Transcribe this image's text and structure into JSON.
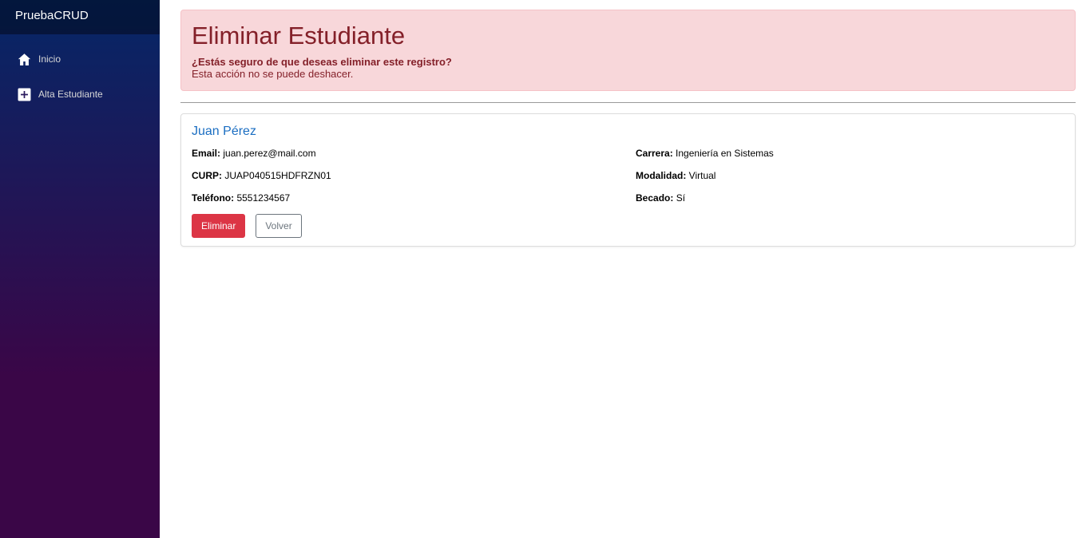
{
  "brand": "PruebaCRUD",
  "nav": {
    "items": [
      {
        "label": "Inicio",
        "icon": "home-icon"
      },
      {
        "label": "Alta Estudiante",
        "icon": "plus-square-icon"
      }
    ]
  },
  "alert": {
    "title": "Eliminar Estudiante",
    "question": "¿Estás seguro de que deseas eliminar este registro?",
    "warning": "Esta acción no se puede deshacer."
  },
  "student": {
    "name": "Juan Pérez",
    "fields": {
      "email": {
        "label": "Email:",
        "value": "juan.perez@mail.com"
      },
      "curp": {
        "label": "CURP:",
        "value": "JUAP040515HDFRZN01"
      },
      "telefono": {
        "label": "Teléfono:",
        "value": "5551234567"
      },
      "carrera": {
        "label": "Carrera:",
        "value": "Ingeniería en Sistemas"
      },
      "modalidad": {
        "label": "Modalidad:",
        "value": "Virtual"
      },
      "becado": {
        "label": "Becado:",
        "value": "Sí"
      }
    }
  },
  "actions": {
    "delete_label": "Eliminar",
    "back_label": "Volver"
  },
  "colors": {
    "sidebar_top": "#052767",
    "sidebar_bottom": "#3a0647",
    "danger": "#dc3545",
    "alert_bg": "#f8d7da",
    "alert_text": "#842029",
    "link": "#1b6ec2"
  }
}
